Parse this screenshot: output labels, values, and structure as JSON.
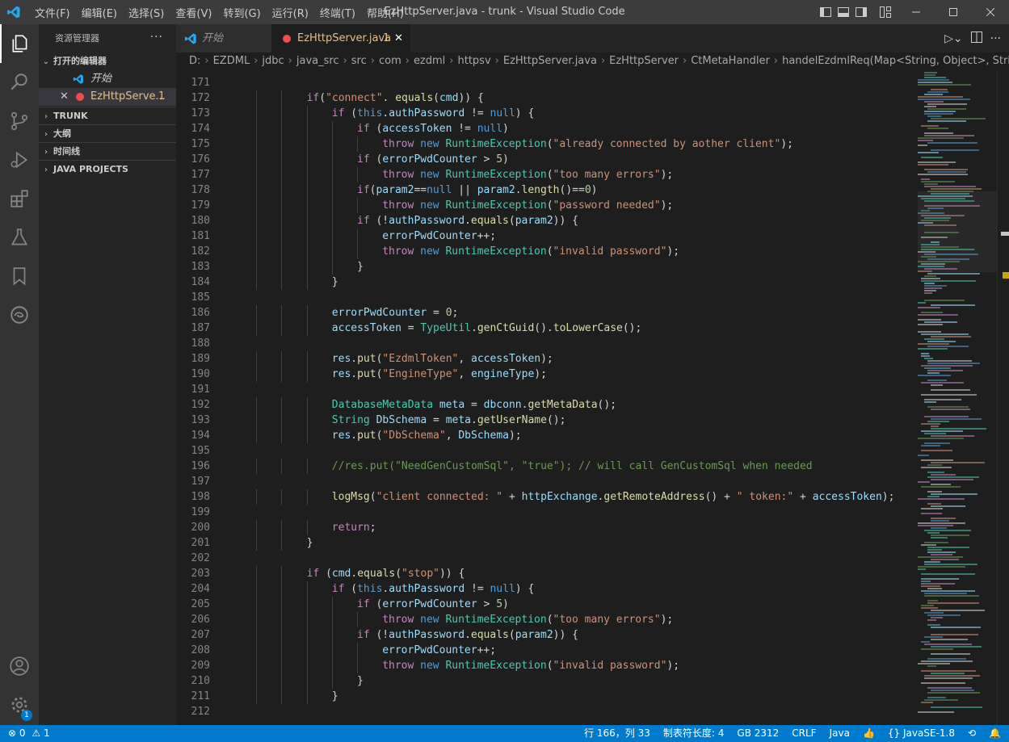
{
  "window": {
    "title": "EzHttpServer.java - trunk - Visual Studio Code",
    "menu": [
      "文件(F)",
      "编辑(E)",
      "选择(S)",
      "查看(V)",
      "转到(G)",
      "运行(R)",
      "终端(T)",
      "帮助(H)"
    ]
  },
  "sidebar": {
    "title": "资源管理器",
    "more": "···",
    "open_editors": "打开的编辑器",
    "open_files": [
      {
        "name": "开始",
        "badge": ""
      },
      {
        "name": "EzHttpServe...",
        "badge": "1"
      }
    ],
    "sections": [
      "TRUNK",
      "大纲",
      "时间线",
      "JAVA PROJECTS"
    ]
  },
  "tabs": [
    {
      "label": "开始",
      "badge": ""
    },
    {
      "label": "EzHttpServer.java",
      "badge": "1"
    }
  ],
  "breadcrumb": [
    "D:",
    "EZDML",
    "jdbc",
    "java_src",
    "src",
    "com",
    "ezdml",
    "httpsv",
    "EzHttpServer.java",
    "EzHttpServer",
    "CtMetaHandler",
    "handelEzdmlReq(Map<String, Object>, String,"
  ],
  "code": {
    "lines": [
      {
        "n": "171",
        "indent": 0,
        "toks": []
      },
      {
        "n": "172",
        "indent": 3,
        "toks": [
          [
            "ctl",
            "if"
          ],
          [
            "",
            "("
          ],
          [
            "str",
            "\"connect\""
          ],
          [
            "",
            ". "
          ],
          [
            "fn",
            "equals"
          ],
          [
            "",
            "("
          ],
          [
            "var",
            "cmd"
          ],
          [
            "",
            ")) {"
          ]
        ]
      },
      {
        "n": "173",
        "indent": 4,
        "toks": [
          [
            "ctl",
            "if"
          ],
          [
            "",
            " ("
          ],
          [
            "kw",
            "this"
          ],
          [
            "",
            "."
          ],
          [
            "var",
            "authPassword"
          ],
          [
            "",
            " != "
          ],
          [
            "kw",
            "null"
          ],
          [
            "",
            ") {"
          ]
        ]
      },
      {
        "n": "174",
        "indent": 5,
        "toks": [
          [
            "ctl",
            "if"
          ],
          [
            "",
            " ("
          ],
          [
            "var",
            "accessToken"
          ],
          [
            "",
            " != "
          ],
          [
            "kw",
            "null"
          ],
          [
            "",
            ")"
          ]
        ]
      },
      {
        "n": "175",
        "indent": 6,
        "toks": [
          [
            "ctl",
            "throw"
          ],
          [
            "",
            " "
          ],
          [
            "kw",
            "new"
          ],
          [
            "",
            " "
          ],
          [
            "ty",
            "RuntimeException"
          ],
          [
            "",
            "("
          ],
          [
            "str",
            "\"already connected by aother client\""
          ],
          [
            "",
            ");"
          ]
        ]
      },
      {
        "n": "176",
        "indent": 5,
        "toks": [
          [
            "ctl",
            "if"
          ],
          [
            "",
            " ("
          ],
          [
            "var",
            "errorPwdCounter"
          ],
          [
            "",
            " > "
          ],
          [
            "num",
            "5"
          ],
          [
            "",
            ")"
          ]
        ]
      },
      {
        "n": "177",
        "indent": 6,
        "toks": [
          [
            "ctl",
            "throw"
          ],
          [
            "",
            " "
          ],
          [
            "kw",
            "new"
          ],
          [
            "",
            " "
          ],
          [
            "ty",
            "RuntimeException"
          ],
          [
            "",
            "("
          ],
          [
            "str",
            "\"too many errors\""
          ],
          [
            "",
            ");"
          ]
        ]
      },
      {
        "n": "178",
        "indent": 5,
        "toks": [
          [
            "ctl",
            "if"
          ],
          [
            "",
            "("
          ],
          [
            "var",
            "param2"
          ],
          [
            "",
            "=="
          ],
          [
            "kw",
            "null"
          ],
          [
            "",
            " || "
          ],
          [
            "var",
            "param2"
          ],
          [
            "",
            "."
          ],
          [
            "fn",
            "length"
          ],
          [
            "",
            "()=="
          ],
          [
            "num",
            "0"
          ],
          [
            "",
            ")"
          ]
        ]
      },
      {
        "n": "179",
        "indent": 6,
        "toks": [
          [
            "ctl",
            "throw"
          ],
          [
            "",
            " "
          ],
          [
            "kw",
            "new"
          ],
          [
            "",
            " "
          ],
          [
            "ty",
            "RuntimeException"
          ],
          [
            "",
            "("
          ],
          [
            "str",
            "\"password needed\""
          ],
          [
            "",
            ");"
          ]
        ]
      },
      {
        "n": "180",
        "indent": 5,
        "toks": [
          [
            "ctl",
            "if"
          ],
          [
            "",
            " (!"
          ],
          [
            "var",
            "authPassword"
          ],
          [
            "",
            "."
          ],
          [
            "fn",
            "equals"
          ],
          [
            "",
            "("
          ],
          [
            "var",
            "param2"
          ],
          [
            "",
            ")) {"
          ]
        ]
      },
      {
        "n": "181",
        "indent": 6,
        "toks": [
          [
            "var",
            "errorPwdCounter"
          ],
          [
            "",
            "++;"
          ]
        ]
      },
      {
        "n": "182",
        "indent": 6,
        "toks": [
          [
            "ctl",
            "throw"
          ],
          [
            "",
            " "
          ],
          [
            "kw",
            "new"
          ],
          [
            "",
            " "
          ],
          [
            "ty",
            "RuntimeException"
          ],
          [
            "",
            "("
          ],
          [
            "str",
            "\"invalid password\""
          ],
          [
            "",
            ");"
          ]
        ]
      },
      {
        "n": "183",
        "indent": 5,
        "toks": [
          [
            "",
            "}"
          ]
        ]
      },
      {
        "n": "184",
        "indent": 4,
        "toks": [
          [
            "",
            "}"
          ]
        ]
      },
      {
        "n": "185",
        "indent": 0,
        "toks": []
      },
      {
        "n": "186",
        "indent": 4,
        "toks": [
          [
            "var",
            "errorPwdCounter"
          ],
          [
            "",
            " = "
          ],
          [
            "num",
            "0"
          ],
          [
            "",
            ";"
          ]
        ]
      },
      {
        "n": "187",
        "indent": 4,
        "toks": [
          [
            "var",
            "accessToken"
          ],
          [
            "",
            " = "
          ],
          [
            "ty",
            "TypeUtil"
          ],
          [
            "",
            "."
          ],
          [
            "fn",
            "genCtGuid"
          ],
          [
            "",
            "()."
          ],
          [
            "fn",
            "toLowerCase"
          ],
          [
            "",
            "();"
          ]
        ]
      },
      {
        "n": "188",
        "indent": 0,
        "toks": []
      },
      {
        "n": "189",
        "indent": 4,
        "toks": [
          [
            "var",
            "res"
          ],
          [
            "",
            "."
          ],
          [
            "fn",
            "put"
          ],
          [
            "",
            "("
          ],
          [
            "str",
            "\"EzdmlToken\""
          ],
          [
            "",
            ", "
          ],
          [
            "var",
            "accessToken"
          ],
          [
            "",
            ");"
          ]
        ]
      },
      {
        "n": "190",
        "indent": 4,
        "toks": [
          [
            "var",
            "res"
          ],
          [
            "",
            "."
          ],
          [
            "fn",
            "put"
          ],
          [
            "",
            "("
          ],
          [
            "str",
            "\"EngineType\""
          ],
          [
            "",
            ", "
          ],
          [
            "var",
            "engineType"
          ],
          [
            "",
            ");"
          ]
        ]
      },
      {
        "n": "191",
        "indent": 0,
        "toks": []
      },
      {
        "n": "192",
        "indent": 4,
        "toks": [
          [
            "ty",
            "DatabaseMetaData"
          ],
          [
            "",
            " "
          ],
          [
            "var",
            "meta"
          ],
          [
            "",
            " = "
          ],
          [
            "var",
            "dbconn"
          ],
          [
            "",
            "."
          ],
          [
            "fn",
            "getMetaData"
          ],
          [
            "",
            "();"
          ]
        ]
      },
      {
        "n": "193",
        "indent": 4,
        "toks": [
          [
            "ty",
            "String"
          ],
          [
            "",
            " "
          ],
          [
            "var",
            "DbSchema"
          ],
          [
            "",
            " = "
          ],
          [
            "var",
            "meta"
          ],
          [
            "",
            "."
          ],
          [
            "fn",
            "getUserName"
          ],
          [
            "",
            "();"
          ]
        ]
      },
      {
        "n": "194",
        "indent": 4,
        "toks": [
          [
            "var",
            "res"
          ],
          [
            "",
            "."
          ],
          [
            "fn",
            "put"
          ],
          [
            "",
            "("
          ],
          [
            "str",
            "\"DbSchema\""
          ],
          [
            "",
            ", "
          ],
          [
            "var",
            "DbSchema"
          ],
          [
            "",
            ");"
          ]
        ]
      },
      {
        "n": "195",
        "indent": 0,
        "toks": []
      },
      {
        "n": "196",
        "indent": 4,
        "toks": [
          [
            "cm",
            "//res.put(\"NeedGenCustomSql\", \"true\"); // will call GenCustomSql when needed"
          ]
        ]
      },
      {
        "n": "197",
        "indent": 0,
        "toks": []
      },
      {
        "n": "198",
        "indent": 4,
        "toks": [
          [
            "fn",
            "logMsg"
          ],
          [
            "",
            "("
          ],
          [
            "str",
            "\"client connected: \""
          ],
          [
            "",
            " + "
          ],
          [
            "var",
            "httpExchange"
          ],
          [
            "",
            "."
          ],
          [
            "fn",
            "getRemoteAddress"
          ],
          [
            "",
            "() + "
          ],
          [
            "str",
            "\" token:\""
          ],
          [
            "",
            " + "
          ],
          [
            "var",
            "accessToken"
          ],
          [
            "",
            ");"
          ]
        ]
      },
      {
        "n": "199",
        "indent": 0,
        "toks": []
      },
      {
        "n": "200",
        "indent": 4,
        "toks": [
          [
            "ctl",
            "return"
          ],
          [
            "",
            ";"
          ]
        ]
      },
      {
        "n": "201",
        "indent": 3,
        "toks": [
          [
            "",
            "}"
          ]
        ]
      },
      {
        "n": "202",
        "indent": 0,
        "toks": []
      },
      {
        "n": "203",
        "indent": 3,
        "toks": [
          [
            "ctl",
            "if"
          ],
          [
            "",
            " ("
          ],
          [
            "var",
            "cmd"
          ],
          [
            "",
            "."
          ],
          [
            "fn",
            "equals"
          ],
          [
            "",
            "("
          ],
          [
            "str",
            "\"stop\""
          ],
          [
            "",
            ")) {"
          ]
        ]
      },
      {
        "n": "204",
        "indent": 4,
        "toks": [
          [
            "ctl",
            "if"
          ],
          [
            "",
            " ("
          ],
          [
            "kw",
            "this"
          ],
          [
            "",
            "."
          ],
          [
            "var",
            "authPassword"
          ],
          [
            "",
            " != "
          ],
          [
            "kw",
            "null"
          ],
          [
            "",
            ") {"
          ]
        ]
      },
      {
        "n": "205",
        "indent": 5,
        "toks": [
          [
            "ctl",
            "if"
          ],
          [
            "",
            " ("
          ],
          [
            "var",
            "errorPwdCounter"
          ],
          [
            "",
            " > "
          ],
          [
            "num",
            "5"
          ],
          [
            "",
            ")"
          ]
        ]
      },
      {
        "n": "206",
        "indent": 6,
        "toks": [
          [
            "ctl",
            "throw"
          ],
          [
            "",
            " "
          ],
          [
            "kw",
            "new"
          ],
          [
            "",
            " "
          ],
          [
            "ty",
            "RuntimeException"
          ],
          [
            "",
            "("
          ],
          [
            "str",
            "\"too many errors\""
          ],
          [
            "",
            ");"
          ]
        ]
      },
      {
        "n": "207",
        "indent": 5,
        "toks": [
          [
            "ctl",
            "if"
          ],
          [
            "",
            " (!"
          ],
          [
            "var",
            "authPassword"
          ],
          [
            "",
            "."
          ],
          [
            "fn",
            "equals"
          ],
          [
            "",
            "("
          ],
          [
            "var",
            "param2"
          ],
          [
            "",
            ")) {"
          ]
        ]
      },
      {
        "n": "208",
        "indent": 6,
        "toks": [
          [
            "var",
            "errorPwdCounter"
          ],
          [
            "",
            "++;"
          ]
        ]
      },
      {
        "n": "209",
        "indent": 6,
        "toks": [
          [
            "ctl",
            "throw"
          ],
          [
            "",
            " "
          ],
          [
            "kw",
            "new"
          ],
          [
            "",
            " "
          ],
          [
            "ty",
            "RuntimeException"
          ],
          [
            "",
            "("
          ],
          [
            "str",
            "\"invalid password\""
          ],
          [
            "",
            ");"
          ]
        ]
      },
      {
        "n": "210",
        "indent": 5,
        "toks": [
          [
            "",
            "}"
          ]
        ]
      },
      {
        "n": "211",
        "indent": 4,
        "toks": [
          [
            "",
            "}"
          ]
        ]
      },
      {
        "n": "212",
        "indent": 0,
        "toks": []
      }
    ]
  },
  "status": {
    "errors": "0",
    "warnings": "1",
    "position": "行 166，列 33",
    "tab_size": "制表符长度: 4",
    "encoding": "GB 2312",
    "eol": "CRLF",
    "language": "Java",
    "jdk": "JavaSE-1.8"
  },
  "icons": {
    "activity": [
      "explorer-icon",
      "search-icon",
      "source-control-icon",
      "run-debug-icon",
      "extensions-icon",
      "testing-icon",
      "bookmarks-icon",
      "edge-icon",
      "account-icon",
      "settings-gear-icon"
    ],
    "settings_badge": "1"
  },
  "colors": {
    "accent": "#007acc",
    "titlebar": "#3c3c3c",
    "editor_bg": "#1e1e1e"
  }
}
